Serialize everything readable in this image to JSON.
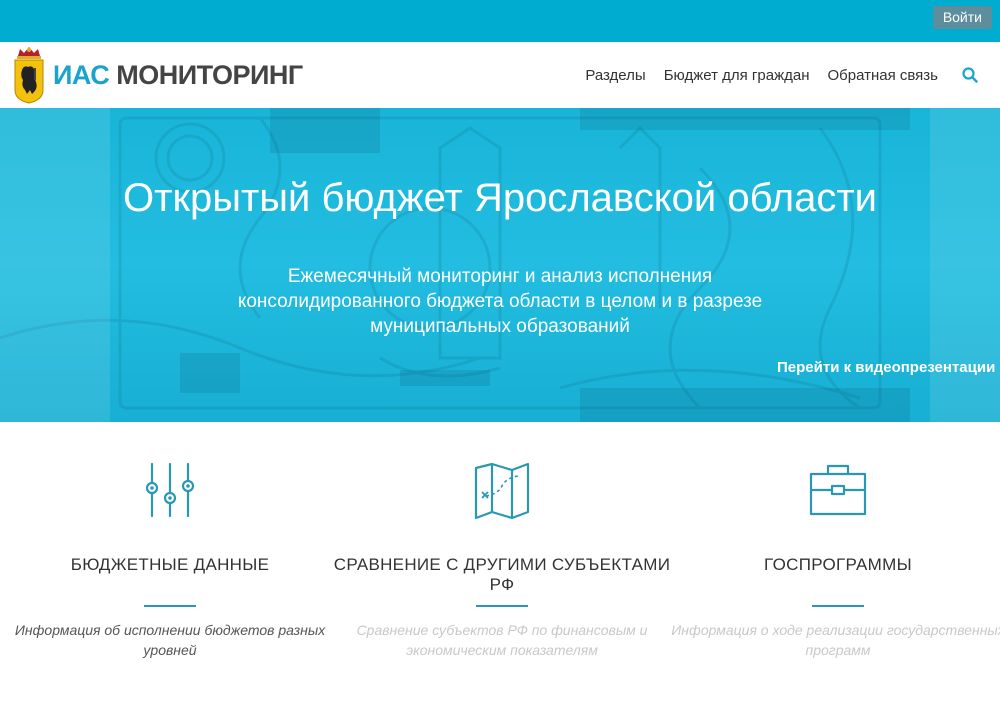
{
  "header": {
    "login_label": "Войти"
  },
  "navbar": {
    "brand_part1": "ИАС",
    "brand_part2": "МОНИТОРИНГ",
    "items": [
      {
        "label": "Разделы"
      },
      {
        "label": "Бюджет для граждан"
      },
      {
        "label": "Обратная связь"
      }
    ],
    "search_icon": "search-icon"
  },
  "hero": {
    "title": "Открытый бюджет Ярославской области",
    "subtitle": "Ежемесячный мониторинг и анализ исполнения консолидированного бюджета области в целом и в разрезе муниципальных образований",
    "video_link": "Перейти к видеопрезентации »"
  },
  "cards": [
    {
      "icon": "sliders-icon",
      "title": "БЮДЖЕТНЫЕ ДАННЫЕ",
      "desc": "Информация об исполнении бюджетов разных уровней",
      "desc_color": "#555555"
    },
    {
      "icon": "map-icon",
      "title": "СРАВНЕНИЕ С ДРУГИМИ СУБЪЕКТАМИ РФ",
      "desc": "Сравнение субъектов РФ по финансовым и экономическим показателям",
      "desc_color": "#c8c8c8"
    },
    {
      "icon": "briefcase-icon",
      "title": "ГОСПРОГРАММЫ",
      "desc": "Информация о ходе реализации государственных программ",
      "desc_color": "#c8c8c8"
    }
  ],
  "colors": {
    "topbar": "#00acd0",
    "accent": "#1aa3cf",
    "icon_stroke": "#2a98b4"
  }
}
